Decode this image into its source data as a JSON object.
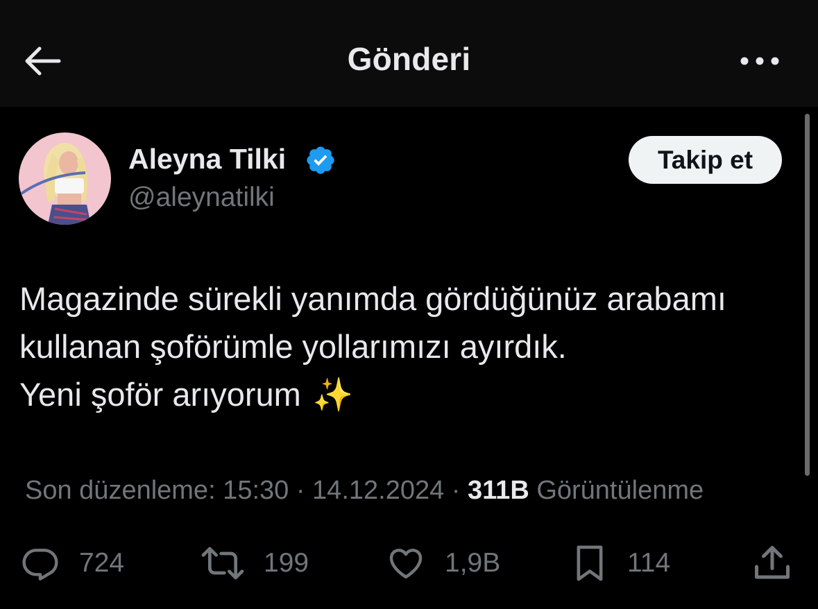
{
  "header": {
    "title": "Gönderi"
  },
  "author": {
    "name": "Aleyna Tilki",
    "handle": "@aleynatilki",
    "verified": true,
    "verified_color": "#1d9bf0"
  },
  "follow_button": {
    "label": "Takip et"
  },
  "tweet": {
    "lines": [
      "Magazinde sürekli yanımda gördüğünüz arabamı",
      "kullanan şoförümle yollarımızı ayırdık.",
      "Yeni şoför arıyorum"
    ],
    "emoji": "✨"
  },
  "meta": {
    "edited_label": "Son düzenleme: 15:30 · 14.12.2024",
    "separator": " · ",
    "views_count": "311B",
    "views_label": " Görüntülenme"
  },
  "actions": {
    "replies": {
      "icon": "reply-icon",
      "count": "724"
    },
    "retweets": {
      "icon": "retweet-icon",
      "count": "199"
    },
    "likes": {
      "icon": "heart-icon",
      "count": "1,9B"
    },
    "bookmarks": {
      "icon": "bookmark-icon",
      "count": "114"
    },
    "share": {
      "icon": "share-icon"
    }
  },
  "colors": {
    "background": "#000000",
    "topbar": "#0c0c0c",
    "primary_text": "#e7e9ea",
    "secondary_text": "#71767b",
    "follow_button_bg": "#eff3f4"
  }
}
